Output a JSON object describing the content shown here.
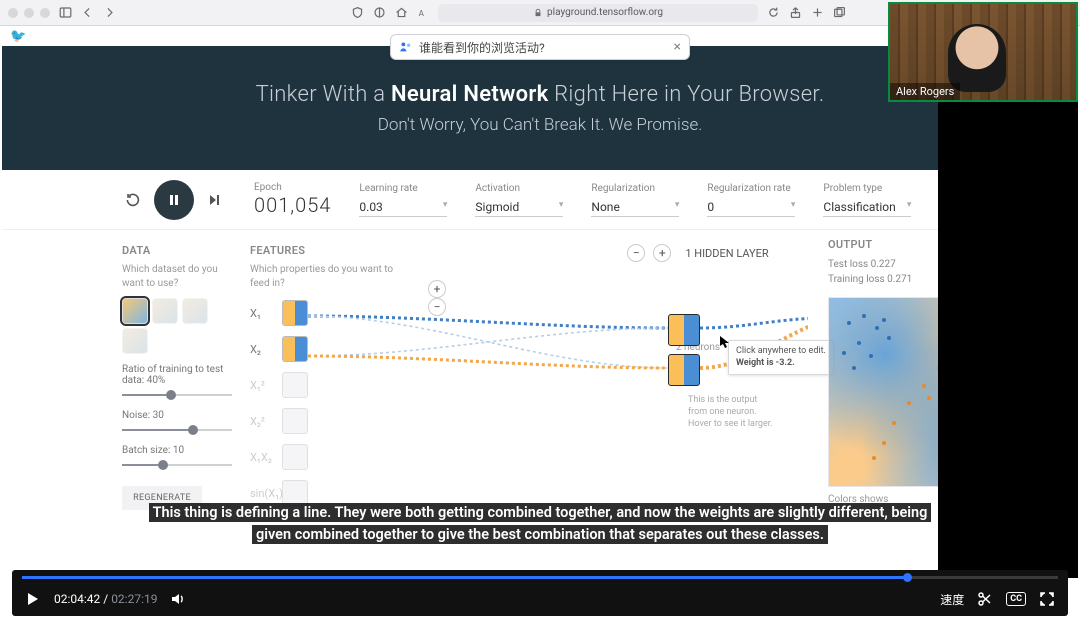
{
  "browser": {
    "url_host": "playground.tensorflow.org",
    "bubble_text": "谁能看到你的浏览活动?"
  },
  "webcam": {
    "name": "Alex Rogers"
  },
  "hero": {
    "prefix": "Tinker With a ",
    "bold": "Neural Network",
    "suffix": " Right Here in Your Browser.",
    "line2": "Don't Worry, You Can't Break It. We Promise."
  },
  "controls": {
    "epoch_label": "Epoch",
    "epoch_value": "001,054",
    "params": [
      {
        "label": "Learning rate",
        "value": "0.03"
      },
      {
        "label": "Activation",
        "value": "Sigmoid"
      },
      {
        "label": "Regularization",
        "value": "None"
      },
      {
        "label": "Regularization rate",
        "value": "0"
      },
      {
        "label": "Problem type",
        "value": "Classification"
      }
    ]
  },
  "data_panel": {
    "header": "DATA",
    "help": "Which dataset do you want to use?",
    "sliders": {
      "ratio": {
        "label": "Ratio of training to test data: 40%",
        "pct": 40
      },
      "noise": {
        "label": "Noise: 30",
        "pct": 60
      },
      "batch": {
        "label": "Batch size: 10",
        "pct": 33
      }
    },
    "regenerate": "REGENERATE"
  },
  "features_panel": {
    "header": "FEATURES",
    "help": "Which properties do you want to feed in?",
    "items": [
      "X₁",
      "X₂",
      "X₁²",
      "X₂²",
      "X₁X₂",
      "sin(X₁)"
    ]
  },
  "hidden": {
    "count_text": "1  HIDDEN LAYER",
    "neurons_text": "2 neurons",
    "tooltip_line1": "Click anywhere to edit.",
    "tooltip_weight": "Weight is -3.2.",
    "hint": "This is the output from one neuron. Hover to see it larger."
  },
  "output": {
    "header": "OUTPUT",
    "test_loss": "Test loss 0.227",
    "train_loss": "Training loss 0.271",
    "footer": "Colors shows"
  },
  "caption": {
    "line1": "This thing is defining a line. They were both getting combined together, and now the weights are slightly different, being",
    "line2": "given combined together to give the best combination that separates out these classes."
  },
  "video": {
    "current": "02:04:42",
    "duration": "02:27:19",
    "progress_pct": 85,
    "speed_label": "速度"
  }
}
